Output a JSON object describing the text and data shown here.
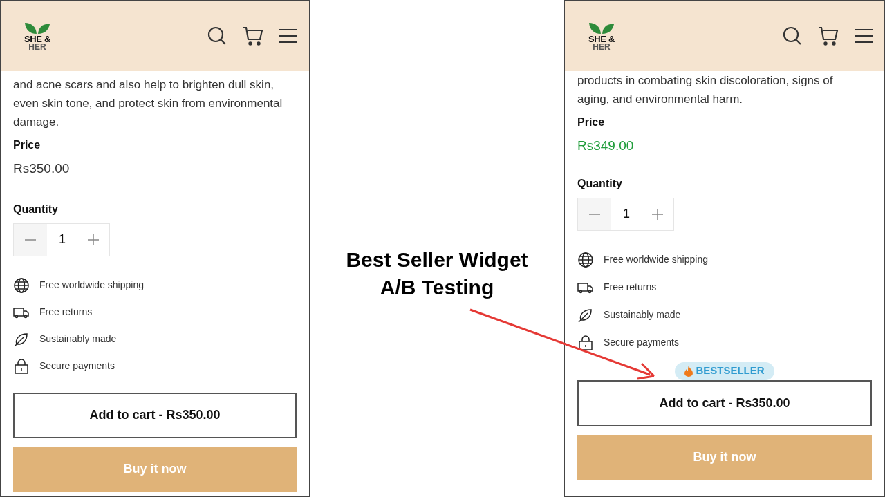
{
  "phones": [
    {
      "logo": {
        "line_1": "SHE &",
        "line_2": "HER"
      },
      "description": "and acne scars and also help to brighten dull skin, even skin tone, and protect skin from environmental damage.",
      "price_label": "Price",
      "price": "Rs350.00",
      "price_highlighted": false,
      "quantity_label": "Quantity",
      "quantity": "1",
      "features": [
        {
          "kind": "globe",
          "text": "Free worldwide shipping"
        },
        {
          "kind": "truck",
          "text": "Free returns"
        },
        {
          "kind": "leaf",
          "text": "Sustainably made"
        },
        {
          "kind": "lock",
          "text": "Secure payments"
        }
      ],
      "add_to_cart": "Add to cart - Rs350.00",
      "buy_now": "Buy it now"
    },
    {
      "logo": {
        "line_1": "SHE &",
        "line_2": "HER"
      },
      "description": "products in combating skin discoloration, signs of aging, and environmental harm.",
      "price_label": "Price",
      "price": "Rs349.00",
      "price_highlighted": true,
      "quantity_label": "Quantity",
      "quantity": "1",
      "features": [
        {
          "kind": "globe",
          "text": "Free worldwide shipping"
        },
        {
          "kind": "truck",
          "text": "Free returns"
        },
        {
          "kind": "leaf",
          "text": "Sustainably made"
        },
        {
          "kind": "lock",
          "text": "Secure payments"
        }
      ],
      "badge": "BESTSELLER",
      "add_to_cart": "Add to cart - Rs350.00",
      "buy_now": "Buy it now"
    }
  ],
  "caption": {
    "line_1": "Best Seller Widget",
    "line_2": "A/B Testing"
  }
}
